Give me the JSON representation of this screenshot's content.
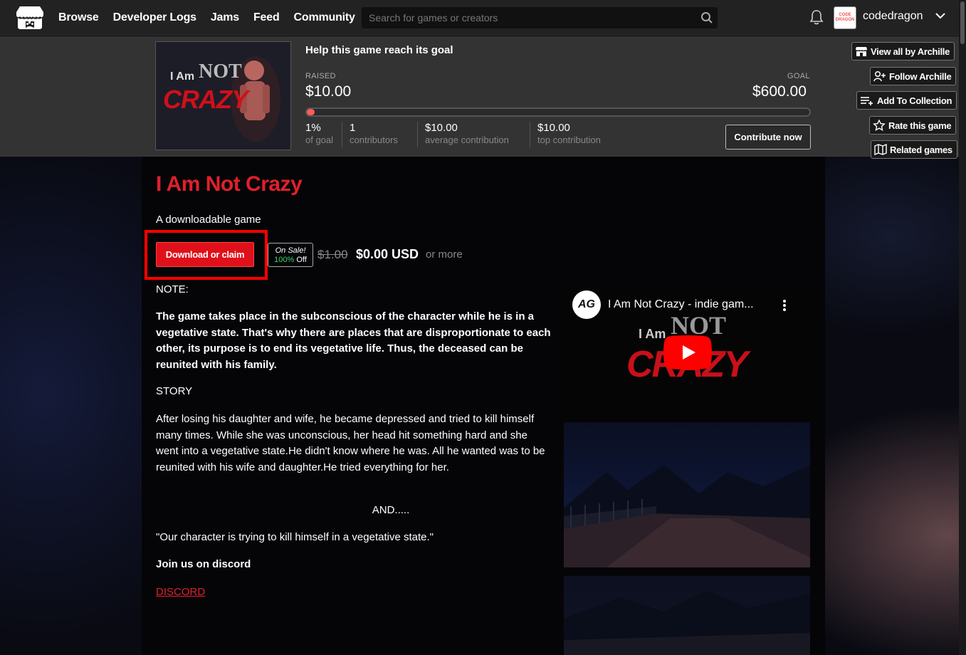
{
  "header": {
    "nav": [
      "Browse",
      "Developer Logs",
      "Jams",
      "Feed",
      "Community"
    ],
    "search_placeholder": "Search for games or creators",
    "username": "codedragon",
    "avatar_text": "CODE DRAGON"
  },
  "goal": {
    "title": "Help this game reach its goal",
    "raised_label": "RAISED",
    "raised_value": "$10.00",
    "goal_label": "GOAL",
    "goal_value": "$600.00",
    "progress_percent": 1,
    "stats": [
      {
        "value": "1%",
        "label": "of goal"
      },
      {
        "value": "1",
        "label": "contributors"
      },
      {
        "value": "$10.00",
        "label": "average contribution"
      },
      {
        "value": "$10.00",
        "label": "top contribution"
      }
    ],
    "contribute_label": "Contribute now",
    "cover_text_top": "I Am",
    "cover_text_not": "NOT",
    "cover_text_main": "CRAZY"
  },
  "side_buttons": {
    "view_all": "View all by Archille",
    "follow": "Follow Archille",
    "collection": "Add To Collection",
    "rate": "Rate this game",
    "related": "Related games"
  },
  "game": {
    "title": "I Am Not Crazy",
    "subtitle": "A downloadable game",
    "download_label": "Download or claim",
    "sale_label": "On Sale!",
    "sale_percent": "100%",
    "sale_off": "Off",
    "price_old": "$1.00",
    "price_new": "$0.00 USD",
    "price_more": "or more"
  },
  "description": {
    "note": "NOTE:",
    "note_body": "The game takes place in the subconscious of the character while he is in a vegetative state. That's why there are places that are disproportionate to each other, its purpose is to end its vegetative life. Thus, the deceased can be reunited with his family.",
    "story": "STORY",
    "story_body": "After losing his daughter and wife, he became depressed and tried to kill himself many times. While she was unconscious, her head hit something hard and she went into a vegetative state.He didn't know where he was. All he wanted was to be reunited with his wife and daughter.He tried everything for her.",
    "and": "AND.....",
    "quote": "\"Our character is trying to kill himself in a vegetative state.\"",
    "join": "Join us on discord",
    "discord": "DISCORD"
  },
  "video": {
    "title": "I Am Not Crazy - indie gam...",
    "channel_logo": "AG"
  },
  "colors": {
    "accent": "#e0202a",
    "progress": "#fa5c5c",
    "sale_green": "#3fd56a",
    "highlight_box": "#ff0000"
  }
}
